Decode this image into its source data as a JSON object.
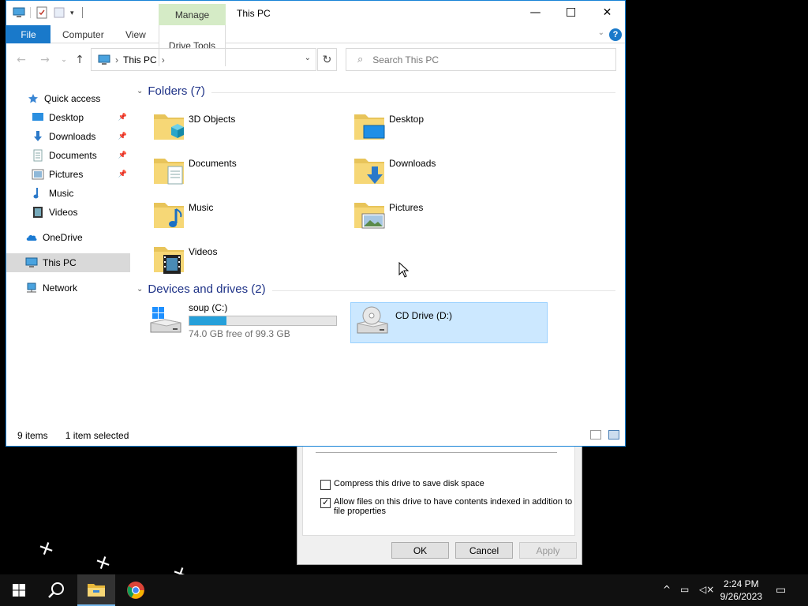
{
  "window": {
    "title": "This PC",
    "manage_tab": "Manage",
    "minimize": "—",
    "maximize": "☐",
    "close": "✕"
  },
  "ribbon": {
    "tabs": [
      "File",
      "Computer",
      "View",
      "Drive Tools"
    ],
    "help": "?"
  },
  "address": {
    "location": "This PC",
    "search_placeholder": "Search This PC"
  },
  "nav": {
    "items": [
      {
        "label": "Quick access",
        "icon": "star-icon"
      },
      {
        "label": "Desktop",
        "icon": "desktop-icon",
        "pinned": true
      },
      {
        "label": "Downloads",
        "icon": "download-icon",
        "pinned": true
      },
      {
        "label": "Documents",
        "icon": "document-icon",
        "pinned": true
      },
      {
        "label": "Pictures",
        "icon": "picture-icon",
        "pinned": true
      },
      {
        "label": "Music",
        "icon": "music-icon"
      },
      {
        "label": "Videos",
        "icon": "video-icon"
      },
      {
        "label": "OneDrive",
        "icon": "cloud-icon"
      },
      {
        "label": "This PC",
        "icon": "computer-icon",
        "selected": true
      },
      {
        "label": "Network",
        "icon": "network-icon"
      }
    ]
  },
  "folders": {
    "header": "Folders (7)",
    "items": [
      "3D Objects",
      "Desktop",
      "Documents",
      "Downloads",
      "Music",
      "Pictures",
      "Videos"
    ]
  },
  "drives": {
    "header": "Devices and drives (2)",
    "items": [
      {
        "name": "soup (C:)",
        "free_text": "74.0 GB free of 99.3 GB",
        "used_fraction": 0.255
      },
      {
        "name": "CD Drive (D:)",
        "selected": true
      }
    ]
  },
  "status": {
    "count": "9 items",
    "selection": "1 item selected"
  },
  "properties_dialog": {
    "compress_label": "Compress this drive to save disk space",
    "compress_checked": false,
    "index_label": "Allow files on this drive to have contents indexed in addition to file properties",
    "index_checked": true,
    "ok": "OK",
    "cancel": "Cancel",
    "apply": "Apply"
  },
  "taskbar": {
    "time": "2:24 PM",
    "date": "9/26/2023"
  },
  "colors": {
    "accent": "#1979ca",
    "selection": "#cce8ff",
    "drive_bar": "#26a0da",
    "manage_tab": "#d5ebc6"
  }
}
